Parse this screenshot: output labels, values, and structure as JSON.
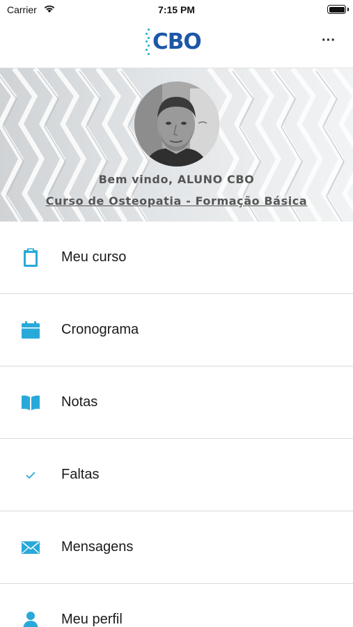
{
  "status_bar": {
    "carrier": "Carrier",
    "time": "7:15 PM"
  },
  "nav": {
    "logo_text": "CBO",
    "more_label": "···"
  },
  "header": {
    "welcome": "Bem vindo, ALUNO CBO",
    "course": "Curso de Osteopatia - Formação Básica"
  },
  "theme": {
    "accent": "#29a9d9",
    "logo_blue": "#1d57a8"
  },
  "menu": {
    "items": [
      {
        "label": "Meu curso",
        "icon": "clipboard-icon"
      },
      {
        "label": "Cronograma",
        "icon": "calendar-icon"
      },
      {
        "label": "Notas",
        "icon": "book-icon"
      },
      {
        "label": "Faltas",
        "icon": "checkmark-icon"
      },
      {
        "label": "Mensagens",
        "icon": "envelope-icon"
      },
      {
        "label": "Meu perfil",
        "icon": "person-icon"
      }
    ]
  }
}
